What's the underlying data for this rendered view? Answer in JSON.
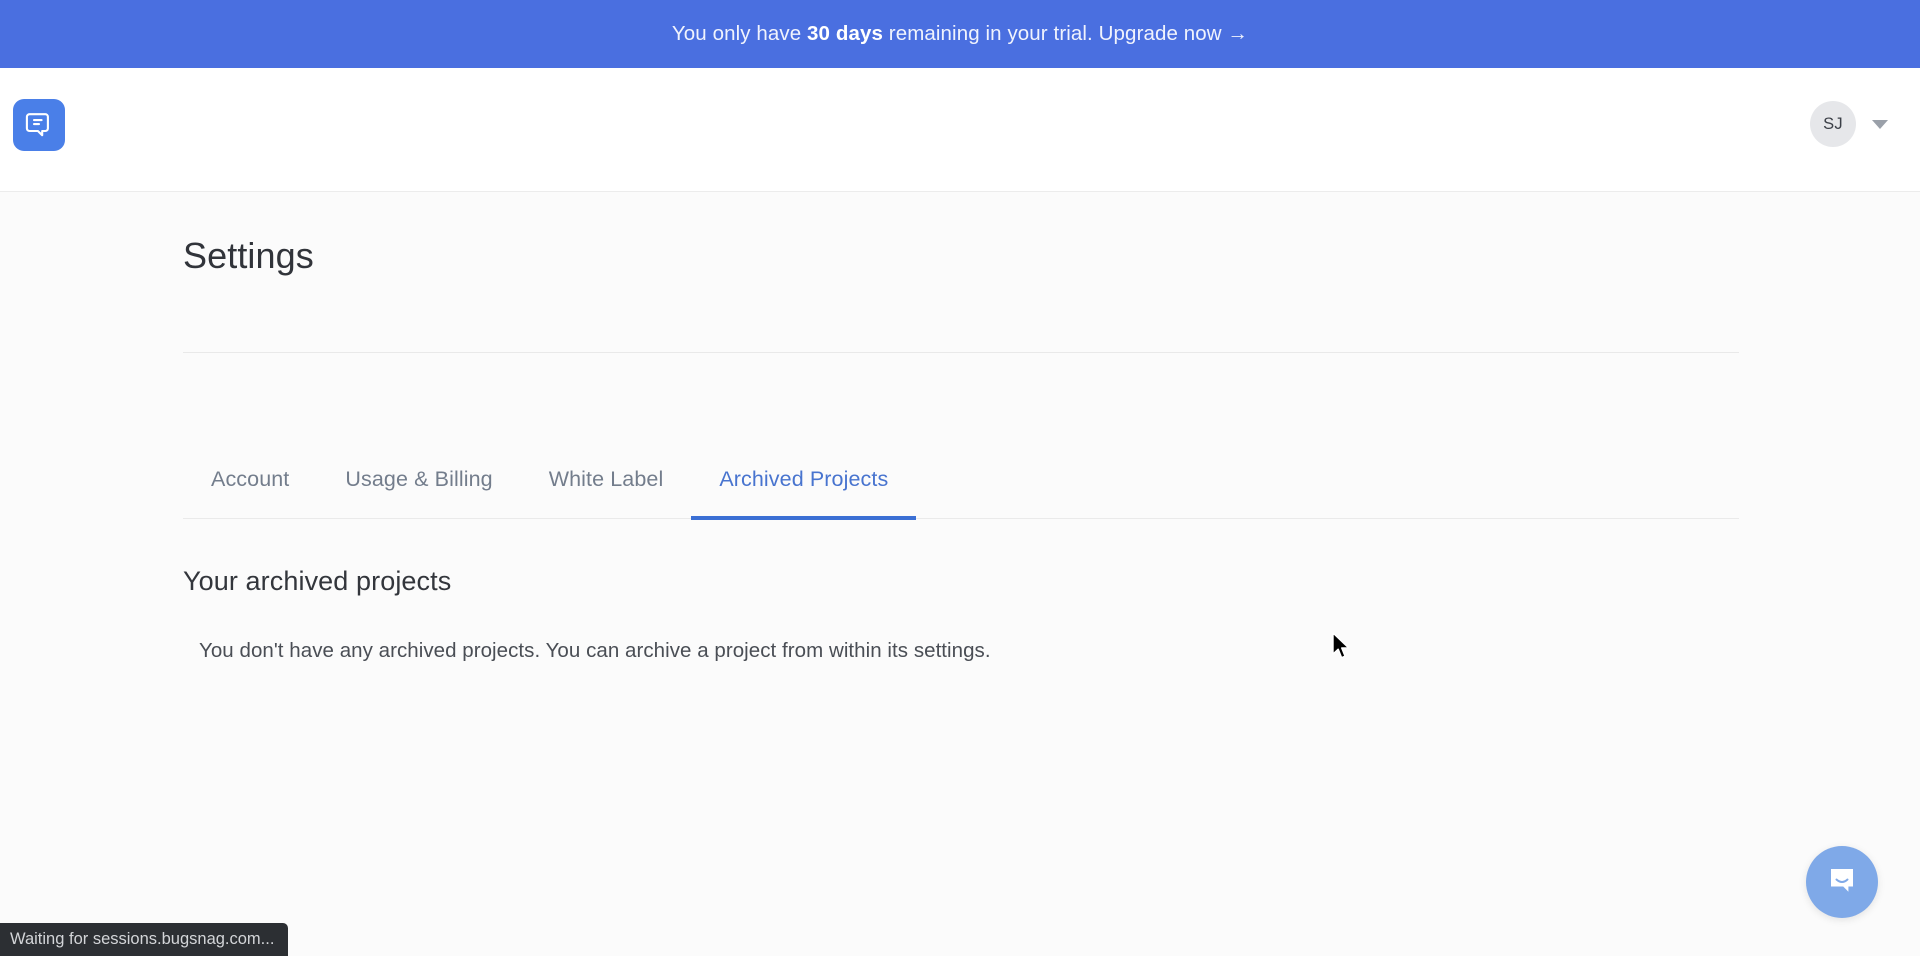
{
  "banner": {
    "text_before": "You only have ",
    "highlight": "30 days",
    "text_after": " remaining in your trial. ",
    "link_label": "Upgrade now →",
    "background_color": "#4a6fe0"
  },
  "header": {
    "logo_icon": "bugsnag-document-icon",
    "logo_color": "#4a7fe8",
    "avatar_initials": "SJ",
    "avatar_caret_icon": "chevron-down-icon"
  },
  "page": {
    "title": "Settings"
  },
  "tabs": [
    {
      "label": "Account",
      "active": false
    },
    {
      "label": "Usage & Billing",
      "active": false
    },
    {
      "label": "White Label",
      "active": false
    },
    {
      "label": "Archived Projects",
      "active": true
    }
  ],
  "archived": {
    "section_title": "Your archived projects",
    "empty_message": "You don't have any archived projects. You can archive a project from within its settings."
  },
  "intercom": {
    "icon": "chat-bubble-icon",
    "color": "#7fa9e8"
  },
  "status_bar": {
    "text": "Waiting for sessions.bugsnag.com..."
  },
  "accent_color": "#3b6fd4"
}
